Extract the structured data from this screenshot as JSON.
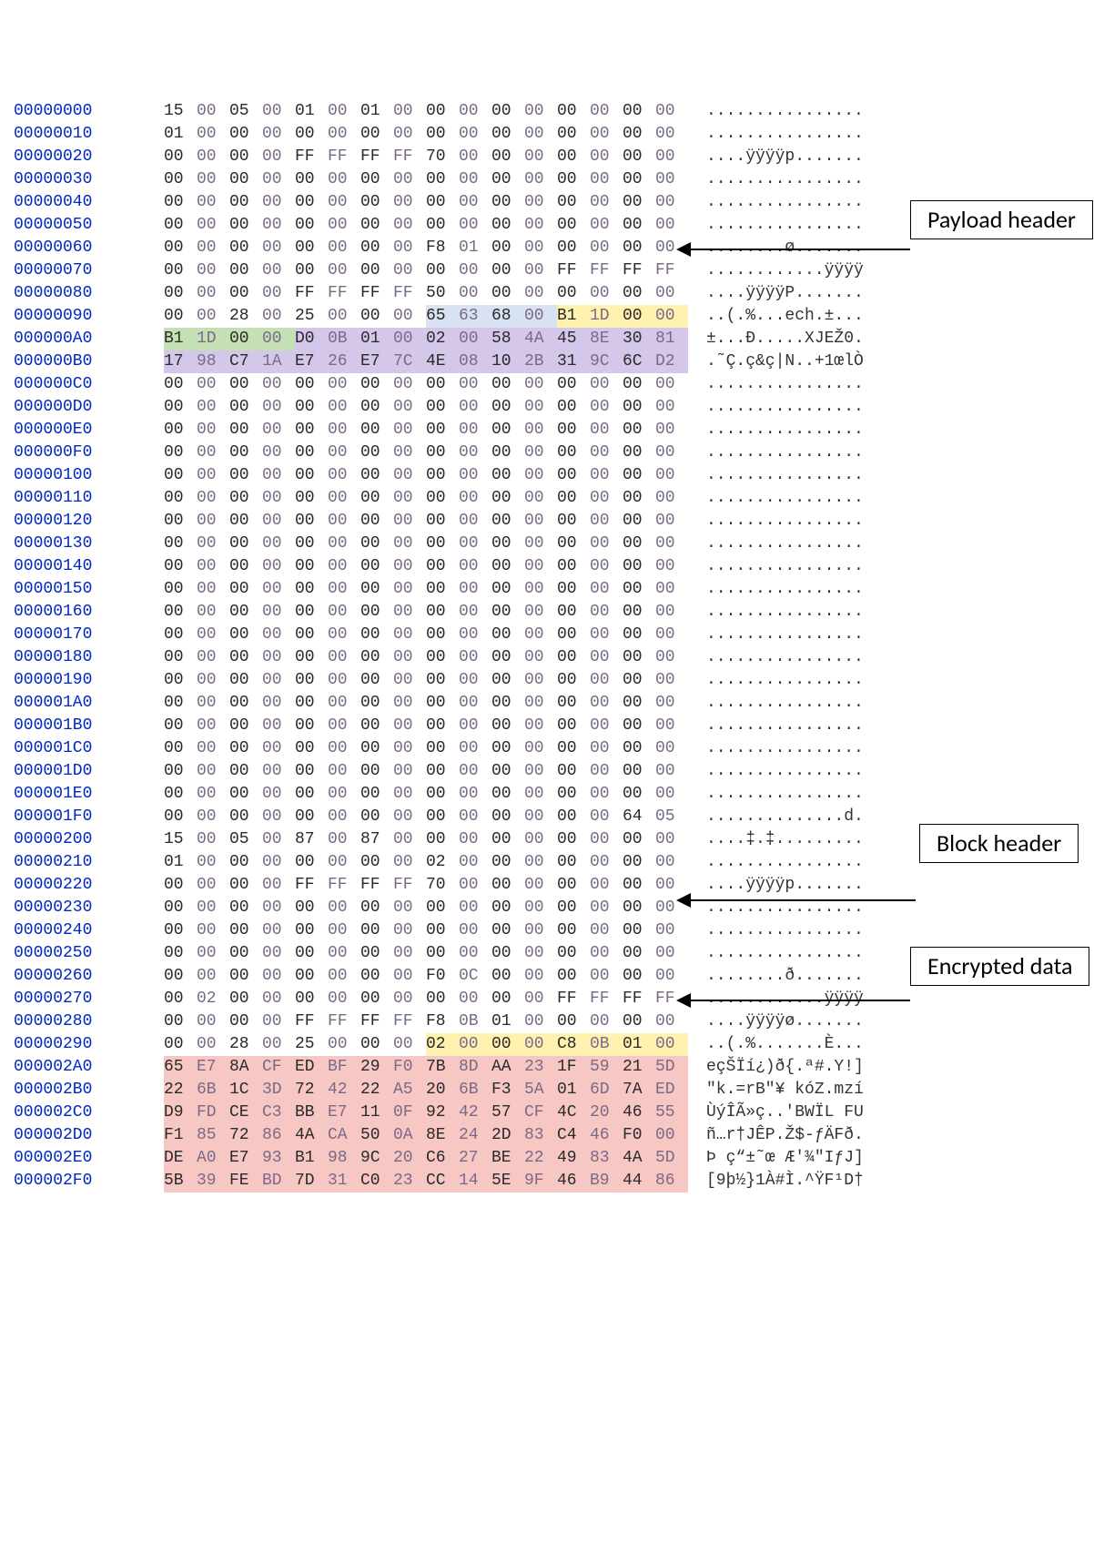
{
  "colors": {
    "offset": "#0028c0",
    "hexDark": "#2a2a2a",
    "hexLight": "#7a6a88",
    "hlBlue": "#d9e2f3",
    "hlYellow": "#fff2b0",
    "hlGreen": "#c5e0b4",
    "hlPurple": "#d4c7ea",
    "hlRed": "#f7c7c4"
  },
  "callouts": {
    "payload": "Payload header",
    "block": "Block header",
    "encrypted": "Encrypted data"
  },
  "rows": [
    {
      "off": "00000000",
      "hex": [
        "15",
        "00",
        "05",
        "00",
        "01",
        "00",
        "01",
        "00",
        "00",
        "00",
        "00",
        "00",
        "00",
        "00",
        "00",
        "00"
      ],
      "asc": "................"
    },
    {
      "off": "00000010",
      "hex": [
        "01",
        "00",
        "00",
        "00",
        "00",
        "00",
        "00",
        "00",
        "00",
        "00",
        "00",
        "00",
        "00",
        "00",
        "00",
        "00"
      ],
      "asc": "................"
    },
    {
      "off": "00000020",
      "hex": [
        "00",
        "00",
        "00",
        "00",
        "FF",
        "FF",
        "FF",
        "FF",
        "70",
        "00",
        "00",
        "00",
        "00",
        "00",
        "00",
        "00"
      ],
      "asc": "....ÿÿÿÿp......."
    },
    {
      "off": "00000030",
      "hex": [
        "00",
        "00",
        "00",
        "00",
        "00",
        "00",
        "00",
        "00",
        "00",
        "00",
        "00",
        "00",
        "00",
        "00",
        "00",
        "00"
      ],
      "asc": "................"
    },
    {
      "off": "00000040",
      "hex": [
        "00",
        "00",
        "00",
        "00",
        "00",
        "00",
        "00",
        "00",
        "00",
        "00",
        "00",
        "00",
        "00",
        "00",
        "00",
        "00"
      ],
      "asc": "................"
    },
    {
      "off": "00000050",
      "hex": [
        "00",
        "00",
        "00",
        "00",
        "00",
        "00",
        "00",
        "00",
        "00",
        "00",
        "00",
        "00",
        "00",
        "00",
        "00",
        "00"
      ],
      "asc": "................"
    },
    {
      "off": "00000060",
      "hex": [
        "00",
        "00",
        "00",
        "00",
        "00",
        "00",
        "00",
        "00",
        "F8",
        "01",
        "00",
        "00",
        "00",
        "00",
        "00",
        "00"
      ],
      "asc": "........ø......."
    },
    {
      "off": "00000070",
      "hex": [
        "00",
        "00",
        "00",
        "00",
        "00",
        "00",
        "00",
        "00",
        "00",
        "00",
        "00",
        "00",
        "FF",
        "FF",
        "FF",
        "FF"
      ],
      "asc": "............ÿÿÿÿ"
    },
    {
      "off": "00000080",
      "hex": [
        "00",
        "00",
        "00",
        "00",
        "FF",
        "FF",
        "FF",
        "FF",
        "50",
        "00",
        "00",
        "00",
        "00",
        "00",
        "00",
        "00"
      ],
      "asc": "....ÿÿÿÿP......."
    },
    {
      "off": "00000090",
      "hex": [
        "00",
        "00",
        "28",
        "00",
        "25",
        "00",
        "00",
        "00",
        "65",
        "63",
        "68",
        "00",
        "B1",
        "1D",
        "00",
        "00"
      ],
      "asc": "..(.%...ech.±...",
      "hl": [
        null,
        null,
        null,
        null,
        null,
        null,
        null,
        null,
        "blue",
        "blue",
        "blue",
        "blue",
        "yellow",
        "yellow",
        "yellow",
        "yellow"
      ]
    },
    {
      "off": "000000A0",
      "hex": [
        "B1",
        "1D",
        "00",
        "00",
        "D0",
        "0B",
        "01",
        "00",
        "02",
        "00",
        "58",
        "4A",
        "45",
        "8E",
        "30",
        "81"
      ],
      "asc": "±...Ð.....XJEŽ0.",
      "hl": [
        "green",
        "green",
        "green",
        "green",
        "purple",
        "purple",
        "purple",
        "purple",
        "purple",
        "purple",
        "purple",
        "purple",
        "purple",
        "purple",
        "purple",
        "purple"
      ]
    },
    {
      "off": "000000B0",
      "hex": [
        "17",
        "98",
        "C7",
        "1A",
        "E7",
        "26",
        "E7",
        "7C",
        "4E",
        "08",
        "10",
        "2B",
        "31",
        "9C",
        "6C",
        "D2"
      ],
      "asc": ".˜Ç.ç&ç|N..+1œlÒ",
      "hl": [
        "purple",
        "purple",
        "purple",
        "purple",
        "purple",
        "purple",
        "purple",
        "purple",
        "purple",
        "purple",
        "purple",
        "purple",
        "purple",
        "purple",
        "purple",
        "purple"
      ]
    },
    {
      "off": "000000C0",
      "hex": [
        "00",
        "00",
        "00",
        "00",
        "00",
        "00",
        "00",
        "00",
        "00",
        "00",
        "00",
        "00",
        "00",
        "00",
        "00",
        "00"
      ],
      "asc": "................"
    },
    {
      "off": "000000D0",
      "hex": [
        "00",
        "00",
        "00",
        "00",
        "00",
        "00",
        "00",
        "00",
        "00",
        "00",
        "00",
        "00",
        "00",
        "00",
        "00",
        "00"
      ],
      "asc": "................"
    },
    {
      "off": "000000E0",
      "hex": [
        "00",
        "00",
        "00",
        "00",
        "00",
        "00",
        "00",
        "00",
        "00",
        "00",
        "00",
        "00",
        "00",
        "00",
        "00",
        "00"
      ],
      "asc": "................"
    },
    {
      "off": "000000F0",
      "hex": [
        "00",
        "00",
        "00",
        "00",
        "00",
        "00",
        "00",
        "00",
        "00",
        "00",
        "00",
        "00",
        "00",
        "00",
        "00",
        "00"
      ],
      "asc": "................"
    },
    {
      "off": "00000100",
      "hex": [
        "00",
        "00",
        "00",
        "00",
        "00",
        "00",
        "00",
        "00",
        "00",
        "00",
        "00",
        "00",
        "00",
        "00",
        "00",
        "00"
      ],
      "asc": "................"
    },
    {
      "off": "00000110",
      "hex": [
        "00",
        "00",
        "00",
        "00",
        "00",
        "00",
        "00",
        "00",
        "00",
        "00",
        "00",
        "00",
        "00",
        "00",
        "00",
        "00"
      ],
      "asc": "................"
    },
    {
      "off": "00000120",
      "hex": [
        "00",
        "00",
        "00",
        "00",
        "00",
        "00",
        "00",
        "00",
        "00",
        "00",
        "00",
        "00",
        "00",
        "00",
        "00",
        "00"
      ],
      "asc": "................"
    },
    {
      "off": "00000130",
      "hex": [
        "00",
        "00",
        "00",
        "00",
        "00",
        "00",
        "00",
        "00",
        "00",
        "00",
        "00",
        "00",
        "00",
        "00",
        "00",
        "00"
      ],
      "asc": "................"
    },
    {
      "off": "00000140",
      "hex": [
        "00",
        "00",
        "00",
        "00",
        "00",
        "00",
        "00",
        "00",
        "00",
        "00",
        "00",
        "00",
        "00",
        "00",
        "00",
        "00"
      ],
      "asc": "................"
    },
    {
      "off": "00000150",
      "hex": [
        "00",
        "00",
        "00",
        "00",
        "00",
        "00",
        "00",
        "00",
        "00",
        "00",
        "00",
        "00",
        "00",
        "00",
        "00",
        "00"
      ],
      "asc": "................"
    },
    {
      "off": "00000160",
      "hex": [
        "00",
        "00",
        "00",
        "00",
        "00",
        "00",
        "00",
        "00",
        "00",
        "00",
        "00",
        "00",
        "00",
        "00",
        "00",
        "00"
      ],
      "asc": "................"
    },
    {
      "off": "00000170",
      "hex": [
        "00",
        "00",
        "00",
        "00",
        "00",
        "00",
        "00",
        "00",
        "00",
        "00",
        "00",
        "00",
        "00",
        "00",
        "00",
        "00"
      ],
      "asc": "................"
    },
    {
      "off": "00000180",
      "hex": [
        "00",
        "00",
        "00",
        "00",
        "00",
        "00",
        "00",
        "00",
        "00",
        "00",
        "00",
        "00",
        "00",
        "00",
        "00",
        "00"
      ],
      "asc": "................"
    },
    {
      "off": "00000190",
      "hex": [
        "00",
        "00",
        "00",
        "00",
        "00",
        "00",
        "00",
        "00",
        "00",
        "00",
        "00",
        "00",
        "00",
        "00",
        "00",
        "00"
      ],
      "asc": "................"
    },
    {
      "off": "000001A0",
      "hex": [
        "00",
        "00",
        "00",
        "00",
        "00",
        "00",
        "00",
        "00",
        "00",
        "00",
        "00",
        "00",
        "00",
        "00",
        "00",
        "00"
      ],
      "asc": "................"
    },
    {
      "off": "000001B0",
      "hex": [
        "00",
        "00",
        "00",
        "00",
        "00",
        "00",
        "00",
        "00",
        "00",
        "00",
        "00",
        "00",
        "00",
        "00",
        "00",
        "00"
      ],
      "asc": "................"
    },
    {
      "off": "000001C0",
      "hex": [
        "00",
        "00",
        "00",
        "00",
        "00",
        "00",
        "00",
        "00",
        "00",
        "00",
        "00",
        "00",
        "00",
        "00",
        "00",
        "00"
      ],
      "asc": "................"
    },
    {
      "off": "000001D0",
      "hex": [
        "00",
        "00",
        "00",
        "00",
        "00",
        "00",
        "00",
        "00",
        "00",
        "00",
        "00",
        "00",
        "00",
        "00",
        "00",
        "00"
      ],
      "asc": "................"
    },
    {
      "off": "000001E0",
      "hex": [
        "00",
        "00",
        "00",
        "00",
        "00",
        "00",
        "00",
        "00",
        "00",
        "00",
        "00",
        "00",
        "00",
        "00",
        "00",
        "00"
      ],
      "asc": "................"
    },
    {
      "off": "000001F0",
      "hex": [
        "00",
        "00",
        "00",
        "00",
        "00",
        "00",
        "00",
        "00",
        "00",
        "00",
        "00",
        "00",
        "00",
        "00",
        "64",
        "05"
      ],
      "asc": "..............d."
    },
    {
      "off": "00000200",
      "hex": [
        "15",
        "00",
        "05",
        "00",
        "87",
        "00",
        "87",
        "00",
        "00",
        "00",
        "00",
        "00",
        "00",
        "00",
        "00",
        "00"
      ],
      "asc": "....‡.‡........."
    },
    {
      "off": "00000210",
      "hex": [
        "01",
        "00",
        "00",
        "00",
        "00",
        "00",
        "00",
        "00",
        "02",
        "00",
        "00",
        "00",
        "00",
        "00",
        "00",
        "00"
      ],
      "asc": "................"
    },
    {
      "off": "00000220",
      "hex": [
        "00",
        "00",
        "00",
        "00",
        "FF",
        "FF",
        "FF",
        "FF",
        "70",
        "00",
        "00",
        "00",
        "00",
        "00",
        "00",
        "00"
      ],
      "asc": "....ÿÿÿÿp......."
    },
    {
      "off": "00000230",
      "hex": [
        "00",
        "00",
        "00",
        "00",
        "00",
        "00",
        "00",
        "00",
        "00",
        "00",
        "00",
        "00",
        "00",
        "00",
        "00",
        "00"
      ],
      "asc": "................"
    },
    {
      "off": "00000240",
      "hex": [
        "00",
        "00",
        "00",
        "00",
        "00",
        "00",
        "00",
        "00",
        "00",
        "00",
        "00",
        "00",
        "00",
        "00",
        "00",
        "00"
      ],
      "asc": "................"
    },
    {
      "off": "00000250",
      "hex": [
        "00",
        "00",
        "00",
        "00",
        "00",
        "00",
        "00",
        "00",
        "00",
        "00",
        "00",
        "00",
        "00",
        "00",
        "00",
        "00"
      ],
      "asc": "................"
    },
    {
      "off": "00000260",
      "hex": [
        "00",
        "00",
        "00",
        "00",
        "00",
        "00",
        "00",
        "00",
        "F0",
        "0C",
        "00",
        "00",
        "00",
        "00",
        "00",
        "00"
      ],
      "asc": "........ð......."
    },
    {
      "off": "00000270",
      "hex": [
        "00",
        "02",
        "00",
        "00",
        "00",
        "00",
        "00",
        "00",
        "00",
        "00",
        "00",
        "00",
        "FF",
        "FF",
        "FF",
        "FF"
      ],
      "asc": "............ÿÿÿÿ"
    },
    {
      "off": "00000280",
      "hex": [
        "00",
        "00",
        "00",
        "00",
        "FF",
        "FF",
        "FF",
        "FF",
        "F8",
        "0B",
        "01",
        "00",
        "00",
        "00",
        "00",
        "00"
      ],
      "asc": "....ÿÿÿÿø......."
    },
    {
      "off": "00000290",
      "hex": [
        "00",
        "00",
        "28",
        "00",
        "25",
        "00",
        "00",
        "00",
        "02",
        "00",
        "00",
        "00",
        "C8",
        "0B",
        "01",
        "00"
      ],
      "asc": "..(.%.......È...",
      "hl": [
        null,
        null,
        null,
        null,
        null,
        null,
        null,
        null,
        "yellow",
        "yellow",
        "yellow",
        "yellow",
        "yellow",
        "yellow",
        "yellow",
        "yellow"
      ]
    },
    {
      "off": "000002A0",
      "hex": [
        "65",
        "E7",
        "8A",
        "CF",
        "ED",
        "BF",
        "29",
        "F0",
        "7B",
        "8D",
        "AA",
        "23",
        "1F",
        "59",
        "21",
        "5D"
      ],
      "asc": "eçŠÏí¿)ð{.ª#.Y!]",
      "hl": [
        "red",
        "red",
        "red",
        "red",
        "red",
        "red",
        "red",
        "red",
        "red",
        "red",
        "red",
        "red",
        "red",
        "red",
        "red",
        "red"
      ]
    },
    {
      "off": "000002B0",
      "hex": [
        "22",
        "6B",
        "1C",
        "3D",
        "72",
        "42",
        "22",
        "A5",
        "20",
        "6B",
        "F3",
        "5A",
        "01",
        "6D",
        "7A",
        "ED"
      ],
      "asc": "\"k.=rB\"¥ kóZ.mzí",
      "hl": [
        "red",
        "red",
        "red",
        "red",
        "red",
        "red",
        "red",
        "red",
        "red",
        "red",
        "red",
        "red",
        "red",
        "red",
        "red",
        "red"
      ]
    },
    {
      "off": "000002C0",
      "hex": [
        "D9",
        "FD",
        "CE",
        "C3",
        "BB",
        "E7",
        "11",
        "0F",
        "92",
        "42",
        "57",
        "CF",
        "4C",
        "20",
        "46",
        "55"
      ],
      "asc": "ÙýÎÃ»ç..'BWÏL FU",
      "hl": [
        "red",
        "red",
        "red",
        "red",
        "red",
        "red",
        "red",
        "red",
        "red",
        "red",
        "red",
        "red",
        "red",
        "red",
        "red",
        "red"
      ]
    },
    {
      "off": "000002D0",
      "hex": [
        "F1",
        "85",
        "72",
        "86",
        "4A",
        "CA",
        "50",
        "0A",
        "8E",
        "24",
        "2D",
        "83",
        "C4",
        "46",
        "F0",
        "00"
      ],
      "asc": "ñ…r†JÊP.Ž$-ƒÄFð.",
      "hl": [
        "red",
        "red",
        "red",
        "red",
        "red",
        "red",
        "red",
        "red",
        "red",
        "red",
        "red",
        "red",
        "red",
        "red",
        "red",
        "red"
      ]
    },
    {
      "off": "000002E0",
      "hex": [
        "DE",
        "A0",
        "E7",
        "93",
        "B1",
        "98",
        "9C",
        "20",
        "C6",
        "27",
        "BE",
        "22",
        "49",
        "83",
        "4A",
        "5D"
      ],
      "asc": "Þ ç“±˜œ Æ'¾\"IƒJ]",
      "hl": [
        "red",
        "red",
        "red",
        "red",
        "red",
        "red",
        "red",
        "red",
        "red",
        "red",
        "red",
        "red",
        "red",
        "red",
        "red",
        "red"
      ]
    },
    {
      "off": "000002F0",
      "hex": [
        "5B",
        "39",
        "FE",
        "BD",
        "7D",
        "31",
        "C0",
        "23",
        "CC",
        "14",
        "5E",
        "9F",
        "46",
        "B9",
        "44",
        "86"
      ],
      "asc": "[9þ½}1À#Ì.^ŸF¹D†",
      "hl": [
        "red",
        "red",
        "red",
        "red",
        "red",
        "red",
        "red",
        "red",
        "red",
        "red",
        "red",
        "red",
        "red",
        "red",
        "red",
        "red"
      ]
    }
  ]
}
